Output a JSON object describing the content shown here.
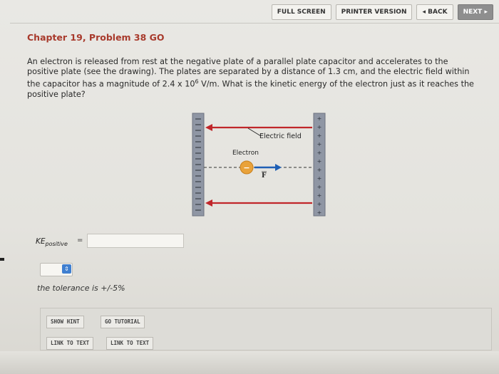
{
  "nav": {
    "full_screen": "FULL SCREEN",
    "printer_version": "PRINTER VERSION",
    "back": "BACK",
    "next": "NEXT"
  },
  "problem": {
    "title": "Chapter 19, Problem 38 GO",
    "text_part1": "An electron is released from rest at the negative plate of a parallel plate capacitor and accelerates to the positive plate (see the drawing). The plates are separated by a distance of 1.3 cm, and the electric field within the capacitor has a magnitude of 2.4 x 10",
    "exponent": "6",
    "text_part2": " V/m. What is the kinetic energy of the electron just as it reaches the positive plate?"
  },
  "figure": {
    "field_label": "Electric field",
    "electron_label": "Electron",
    "force_label": "F",
    "electron_sign": "−",
    "plus_sign": "+"
  },
  "answer": {
    "label_main": "KE",
    "label_sub": "positive",
    "equals": "=",
    "value": "",
    "unit_selected": ""
  },
  "tolerance": "the tolerance is +/-5%",
  "buttons": {
    "show_hint": "SHOW HINT",
    "go_tutorial": "GO TUTORIAL",
    "link_to_text_1": "LINK TO TEXT",
    "link_to_text_2": "LINK TO TEXT"
  },
  "colors": {
    "title": "#a83a2c",
    "field_line": "#c0262a",
    "plate": "#8f96a4",
    "electron": "#e9a23a",
    "force_arrow": "#1f5fb5"
  }
}
